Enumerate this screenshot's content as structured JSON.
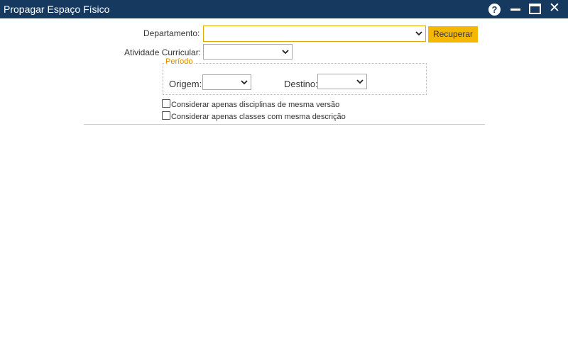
{
  "window": {
    "title": "Propagar Espaço Físico",
    "help_glyph": "?",
    "close_glyph": "✕",
    "bar_color": "#163a5f"
  },
  "form": {
    "departamento_label": "Departamento:",
    "departamento_value": "",
    "recuperar_label": "Recuperar",
    "atividade_label": "Atividade Curricular:",
    "atividade_value": "",
    "periodo_legend": "Período",
    "origem_label": "Origem:",
    "origem_value": "",
    "destino_label": "Destino:",
    "destino_value": "",
    "checkbox_versao_label": "Considerar apenas disciplinas de mesma versão",
    "checkbox_versao_checked": false,
    "checkbox_descricao_label": "Considerar apenas classes com mesma descrição",
    "checkbox_descricao_checked": false,
    "accent_color": "#f5b800",
    "legend_color": "#e08a00"
  }
}
